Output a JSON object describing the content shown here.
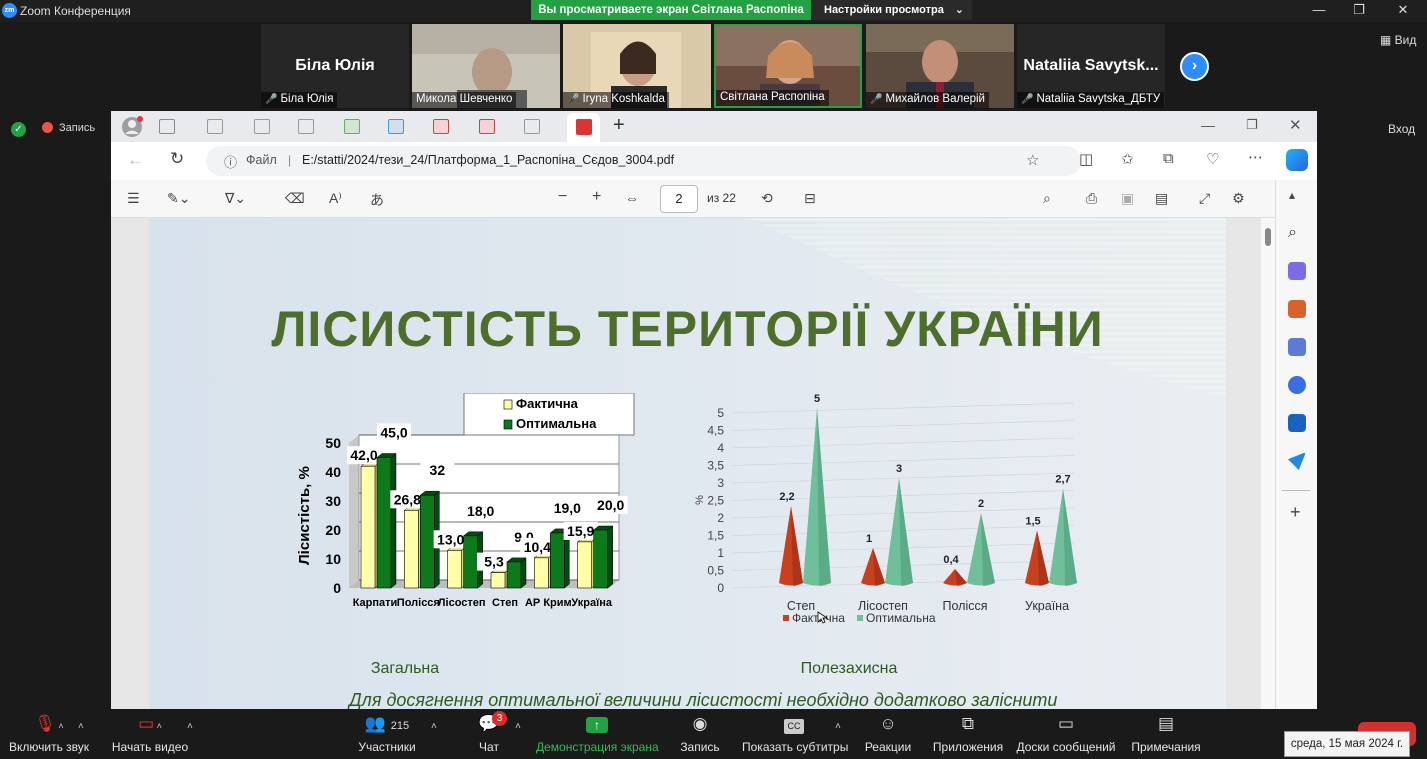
{
  "app": {
    "title": "Zoom Конференция"
  },
  "share_banner": {
    "viewing": "Вы просматриваете экран Світлана Распопіна",
    "options": "Настройки просмотра"
  },
  "gallery": [
    {
      "name": "Біла Юлія",
      "display_name": "Біла Юлія",
      "video": false,
      "muted": true
    },
    {
      "name": "Микола Шевченко",
      "video": true,
      "muted": false
    },
    {
      "name": "Iryna Koshkalda",
      "video": true,
      "muted": true
    },
    {
      "name": "Світлана Распопіна",
      "video": true,
      "muted": false,
      "active_speaker": true
    },
    {
      "name": "Михайлов Валерій",
      "video": true,
      "muted": true
    },
    {
      "name": "Nataliia Savytska_ДБТУ",
      "display_name": "Nataliia  Savytsk...",
      "video": false,
      "muted": true
    }
  ],
  "top_right": {
    "view": "Вид",
    "enter": "Вход"
  },
  "recording": {
    "label": "Запись"
  },
  "browser": {
    "url_prefix": "Файл",
    "url": "E:/statti/2024/тези_24/Платформа_1_Распопіна_Сєдов_3004.pdf",
    "page": "2",
    "page_count": "из 22"
  },
  "slide": {
    "title": "ЛІСИСТІСТЬ ТЕРИТОРІЇ УКРАЇНИ",
    "caption_left": "Загальна",
    "caption_right": "Полезахисна",
    "footer_text": "Для досягнення оптимальної величини лісистості необхідно додатково заліснити"
  },
  "chart_data": [
    {
      "type": "bar",
      "ylabel": "Лісистість, %",
      "ylim": [
        0,
        50
      ],
      "yticks": [
        0,
        10,
        20,
        30,
        40,
        50
      ],
      "categories": [
        "Карпати",
        "Полісся",
        "Лісостеп",
        "Степ",
        "АР Крим",
        "Україна"
      ],
      "series": [
        {
          "name": "Фактична",
          "color": "#ffffa8",
          "values": [
            42.0,
            26.8,
            13.0,
            5.3,
            10.4,
            15.9
          ],
          "labels": [
            "42,0",
            "26,8",
            "13,0",
            "5,3",
            "10,4",
            "15,9"
          ]
        },
        {
          "name": "Оптимальна",
          "color": "#0c7a1a",
          "values": [
            45.0,
            32.0,
            18.0,
            9.0,
            19.0,
            20.0
          ],
          "labels": [
            "45,0",
            "32",
            "18,0",
            "9,0",
            "19,0",
            "20,0"
          ]
        }
      ],
      "legend": "top-right",
      "grid": true
    },
    {
      "type": "bar",
      "style": "3d-cone",
      "ylabel": "%",
      "ylim": [
        0,
        5
      ],
      "yticks": [
        "0",
        "0,5",
        "1",
        "1,5",
        "2",
        "2,5",
        "3",
        "3,5",
        "4",
        "4,5",
        "5"
      ],
      "categories": [
        "Степ",
        "Лісостеп",
        "Полісся",
        "Україна"
      ],
      "series": [
        {
          "name": "Фактична",
          "color": "#c8401e",
          "values": [
            2.2,
            1,
            0.4,
            1.5
          ],
          "labels": [
            "2,2",
            "1",
            "0,4",
            "1,5"
          ]
        },
        {
          "name": "Оптимальна",
          "color": "#6fbf9a",
          "values": [
            5,
            3,
            2,
            2.7
          ],
          "labels": [
            "5",
            "3",
            "2",
            "2,7"
          ]
        }
      ],
      "legend": "bottom",
      "grid": false
    }
  ],
  "toolbar": {
    "mute": "Включить звук",
    "video": "Начать видео",
    "participants": "Участники",
    "participants_count": "215",
    "chat": "Чат",
    "chat_badge": "3",
    "share": "Демонстрация экрана",
    "record": "Запись",
    "captions": "Показать субтитры",
    "reactions": "Реакции",
    "apps": "Приложения",
    "whiteboards": "Доски сообщений",
    "notes": "Примечания"
  },
  "taskbar": {
    "date": "среда, 15 мая 2024 г."
  }
}
